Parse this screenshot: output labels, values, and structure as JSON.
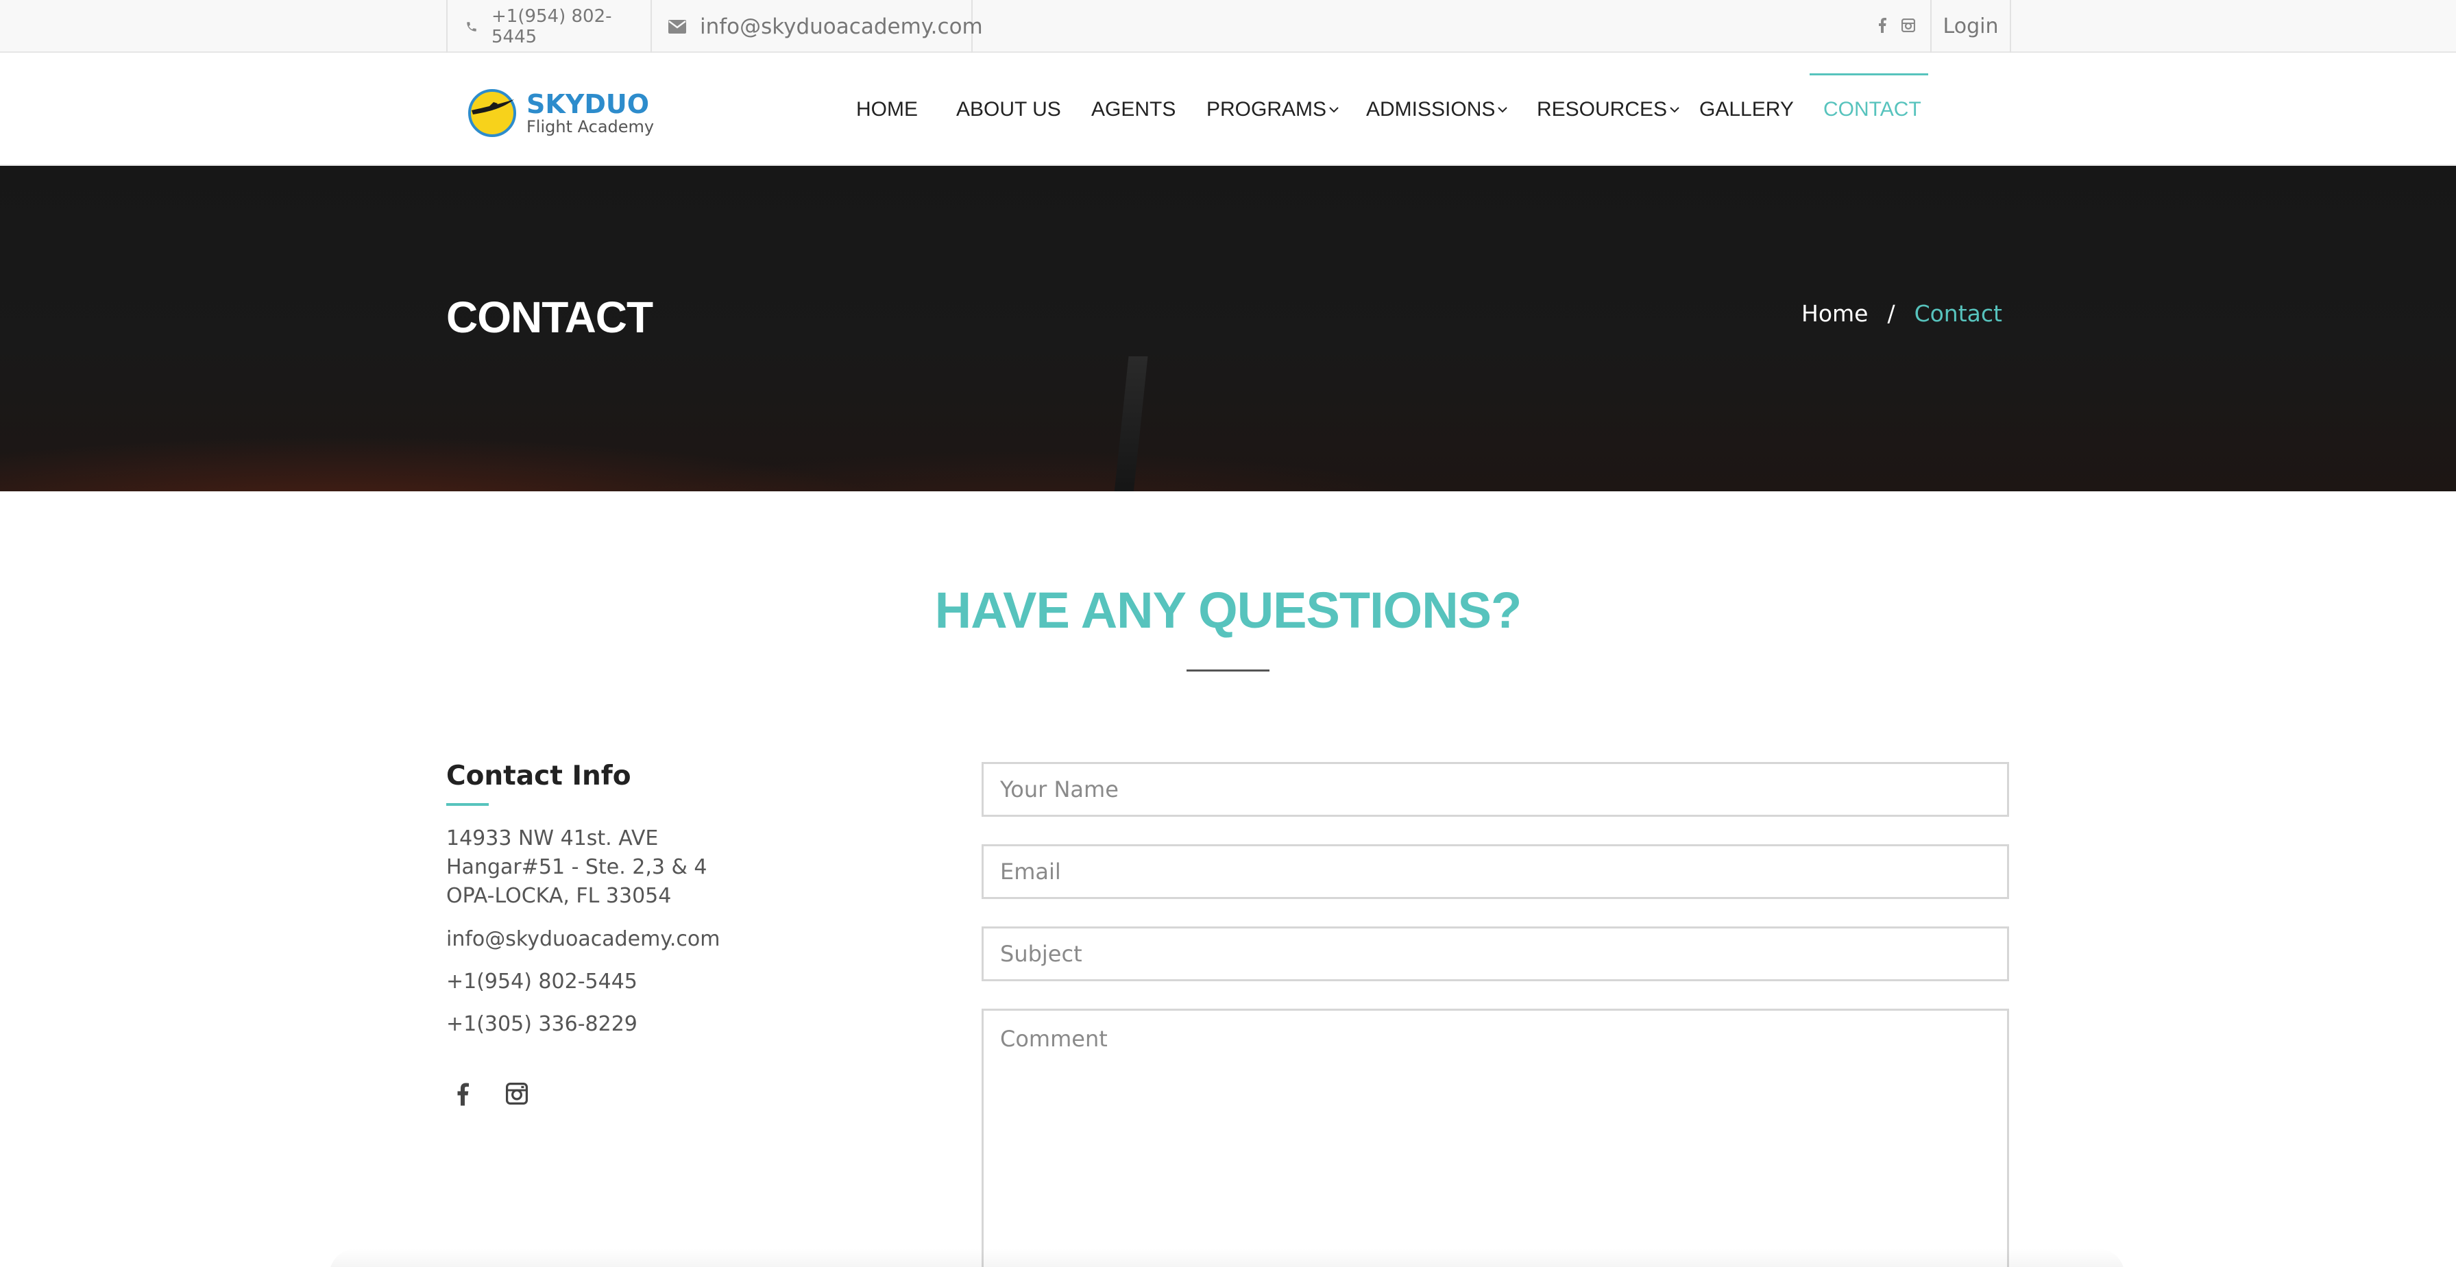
{
  "topbar": {
    "phone": "+1(954) 802-5445",
    "email": "info@skyduoacademy.com",
    "social_icons": [
      "facebook-icon",
      "instagram-icon"
    ],
    "login": "Login"
  },
  "logo": {
    "name": "SKYDUO",
    "subtitle": "Flight Academy"
  },
  "nav": {
    "items": [
      {
        "label": "HOME"
      },
      {
        "label": "ABOUT US"
      },
      {
        "label": "AGENTS"
      },
      {
        "label": "PROGRAMS"
      },
      {
        "label": "ADMISSIONS"
      },
      {
        "label": "RESOURCES"
      },
      {
        "label": "GALLERY"
      },
      {
        "label": "CONTACT",
        "active": true
      }
    ]
  },
  "banner": {
    "title": "CONTACT",
    "breadcrumb": {
      "home": "Home",
      "separator": "/",
      "current": "Contact"
    }
  },
  "section": {
    "title": "HAVE ANY QUESTIONS?"
  },
  "contact_info": {
    "title": "Contact Info",
    "address": [
      "14933 NW 41st. AVE",
      "Hangar#51 - Ste. 2,3 & 4",
      "OPA-LOCKA, FL 33054"
    ],
    "email": "info@skyduoacademy.com",
    "phone1": "+1(954) 802-5445",
    "phone2": "+1(305) 336-8229",
    "social_icons": [
      "facebook-icon",
      "instagram-icon"
    ]
  },
  "form": {
    "name_placeholder": "Your Name",
    "email_placeholder": "Email",
    "subject_placeholder": "Subject",
    "comment_placeholder": "Comment"
  },
  "colors": {
    "accent": "#57c3bd",
    "logo_blue": "#2d8ccc",
    "banner_dark": "#171717"
  }
}
